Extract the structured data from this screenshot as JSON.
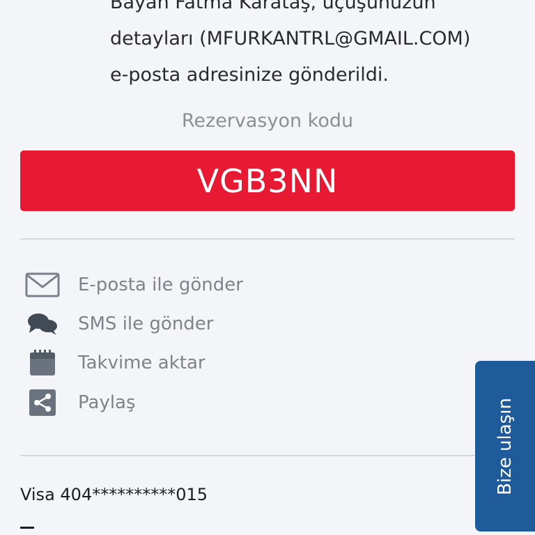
{
  "confirmation": {
    "line1": "Bayan Fatma Karataş, uçuşunuzun",
    "line2": "detayları (MFURKANTRL@GMAIL.COM)",
    "line3": "e-posta adresinize gönderildi."
  },
  "reservation": {
    "label": "Rezervasyon kodu",
    "code": "VGB3NN"
  },
  "actions": [
    {
      "label": "E-posta ile gönder",
      "icon": "envelope-icon"
    },
    {
      "label": "SMS ile gönder",
      "icon": "chat-bubbles-icon"
    },
    {
      "label": "Takvime aktar",
      "icon": "calendar-icon"
    },
    {
      "label": "Paylaş",
      "icon": "share-icon"
    }
  ],
  "payment": {
    "card": "Visa 404**********015"
  },
  "contact_tab": {
    "label": "Bize ulaşın"
  },
  "colors": {
    "background": "#f3f5f9",
    "accent_red": "#e81932",
    "contact_blue": "#1f5a9a",
    "icon_gray": "#7b8189"
  }
}
